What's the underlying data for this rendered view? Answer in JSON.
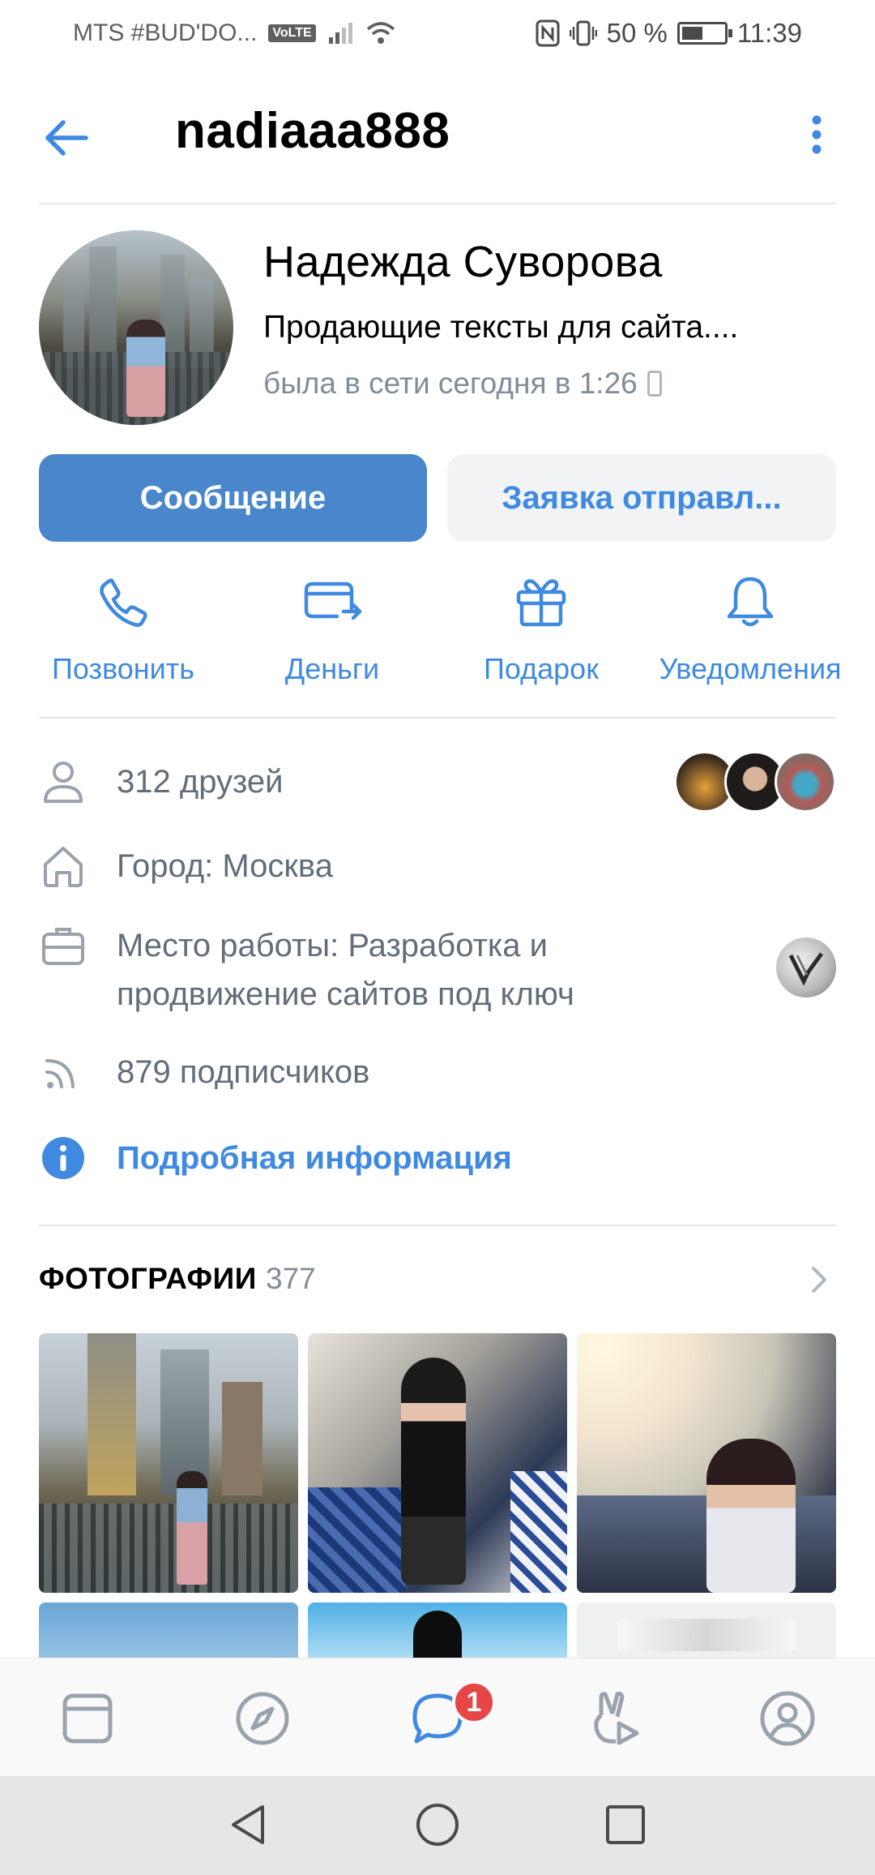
{
  "status_bar": {
    "carrier": "MTS #BUD'DO...",
    "volte": "VoLTE",
    "battery": "50 %",
    "battery_level": 0.5,
    "time": "11:39"
  },
  "header": {
    "username": "nadiaaa888"
  },
  "profile": {
    "name": "Надежда Суворова",
    "status": "Продающие тексты для сайта....",
    "online": "была в сети сегодня в 1:26"
  },
  "buttons": {
    "message": "Сообщение",
    "request": "Заявка отправл..."
  },
  "actions": [
    {
      "label": "Позвонить",
      "icon": "phone-icon"
    },
    {
      "label": "Деньги",
      "icon": "money-transfer-icon"
    },
    {
      "label": "Подарок",
      "icon": "gift-icon"
    },
    {
      "label": "Уведомления",
      "icon": "bell-icon"
    }
  ],
  "info": {
    "friends": "312 друзей",
    "city": "Город: Москва",
    "work": "Место работы: Разработка и продвижение сайтов под ключ",
    "work_line1": "Место работы: Разработка и",
    "work_line2": "продвижение сайтов под ключ",
    "followers": "879 подписчиков",
    "details": "Подробная информация"
  },
  "photos": {
    "title": "ФОТОГРАФИИ",
    "count": "377"
  },
  "tabbar": {
    "items": [
      "news-tab",
      "discover-tab",
      "messages-tab",
      "clips-tab",
      "profile-tab"
    ],
    "messages_badge": "1"
  },
  "colors": {
    "accent": "#3f8ae0",
    "primary_button": "#4986cc",
    "secondary_text": "#818c99",
    "badge": "#e64646"
  }
}
